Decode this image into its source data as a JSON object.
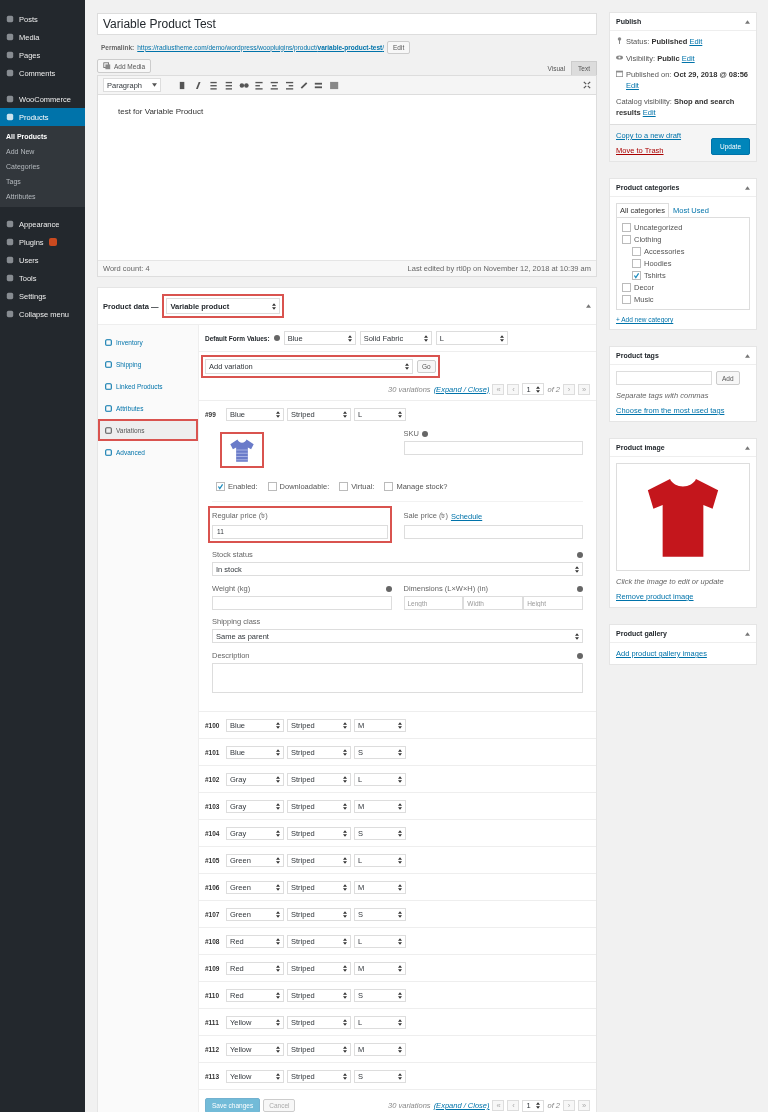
{
  "sidebar": {
    "groups": [
      [
        {
          "label": "Posts",
          "selected": false,
          "badge": false
        },
        {
          "label": "Media",
          "selected": false,
          "badge": false
        },
        {
          "label": "Pages",
          "selected": false,
          "badge": false
        },
        {
          "label": "Comments",
          "selected": false,
          "badge": false
        }
      ],
      [
        {
          "label": "WooCommerce",
          "selected": false,
          "badge": false
        },
        {
          "label": "Products",
          "selected": true,
          "badge": false,
          "children": [
            {
              "label": "All Products",
              "selected": true
            },
            {
              "label": "Add New",
              "selected": false
            },
            {
              "label": "Categories",
              "selected": false
            },
            {
              "label": "Tags",
              "selected": false
            },
            {
              "label": "Attributes",
              "selected": false
            }
          ]
        }
      ],
      [
        {
          "label": "Appearance",
          "selected": false,
          "badge": false
        },
        {
          "label": "Plugins",
          "selected": false,
          "badge": true
        },
        {
          "label": "Users",
          "selected": false,
          "badge": false
        },
        {
          "label": "Tools",
          "selected": false,
          "badge": false
        },
        {
          "label": "Settings",
          "selected": false,
          "badge": false
        },
        {
          "label": "Collapse menu",
          "selected": false,
          "badge": false
        }
      ]
    ]
  },
  "editor": {
    "title": "Variable Product Test",
    "permalink_label": "Permalink:",
    "permalink": "https://radiustheme.com/demo/wordpress/woopluigins/product/**variable-product-test**/",
    "edit_button": "Edit",
    "add_media": "Add Media",
    "tabs": [
      {
        "label": "Visual",
        "selected": false
      },
      {
        "label": "Text",
        "selected": true
      }
    ],
    "format": "Paragraph",
    "content": "test for Variable Product",
    "word_count": "Word count: 4",
    "last_edited": "Last edited by rtl0p on November 12, 2018 at 10:39 am"
  },
  "product_data": {
    "label": "Product data —",
    "type": {
      "value": "Variable product",
      "highlighted": true
    },
    "tabs": [
      {
        "label": "Inventory",
        "selected": false,
        "highlighted": false
      },
      {
        "label": "Shipping",
        "selected": false,
        "highlighted": false
      },
      {
        "label": "Linked Products",
        "selected": false,
        "highlighted": false
      },
      {
        "label": "Attributes",
        "selected": false,
        "highlighted": false
      },
      {
        "label": "Variations",
        "selected": true,
        "highlighted": true
      },
      {
        "label": "Advanced",
        "selected": false,
        "highlighted": false
      }
    ],
    "default_label": "Default Form Values:",
    "defaults": [
      "Blue",
      "Solid Fabric",
      "L"
    ],
    "bulk": {
      "value": "Add variation",
      "button": "Go",
      "highlighted": true
    },
    "pager": {
      "count": "30 variations",
      "toggle": "(Expand / Close)",
      "first": "«",
      "prev": "‹",
      "page": "1",
      "of": "of 2",
      "next": "›",
      "last": "»"
    },
    "variations": [
      {
        "id": "#99",
        "attributes": [
          "Blue",
          "Striped",
          "L"
        ],
        "details": {
          "image_highlighted": true,
          "sku_label": "SKU",
          "options": [
            {
              "label": "Enabled:",
              "checked": true
            },
            {
              "label": "Downloadable:",
              "checked": false
            },
            {
              "label": "Virtual:",
              "checked": false
            },
            {
              "label": "Manage stock?",
              "checked": false
            }
          ],
          "regular_price_label": "Regular price (৳)",
          "regular_price": "11",
          "price_highlighted": true,
          "sale_price_label": "Sale price (৳)",
          "schedule": "Schedule",
          "stock_label": "Stock status",
          "stock": "In stock",
          "weight_label": "Weight (kg)",
          "dimensions_label": "Dimensions (L×W×H) (in)",
          "dimension_placeholders": [
            "Length",
            "Width",
            "Height"
          ],
          "shipping_label": "Shipping class",
          "shipping": "Same as parent",
          "description_label": "Description"
        }
      },
      {
        "id": "#100",
        "attributes": [
          "Blue",
          "Striped",
          "M"
        ]
      },
      {
        "id": "#101",
        "attributes": [
          "Blue",
          "Striped",
          "S"
        ]
      },
      {
        "id": "#102",
        "attributes": [
          "Gray",
          "Striped",
          "L"
        ]
      },
      {
        "id": "#103",
        "attributes": [
          "Gray",
          "Striped",
          "M"
        ]
      },
      {
        "id": "#104",
        "attributes": [
          "Gray",
          "Striped",
          "S"
        ]
      },
      {
        "id": "#105",
        "attributes": [
          "Green",
          "Striped",
          "L"
        ]
      },
      {
        "id": "#106",
        "attributes": [
          "Green",
          "Striped",
          "M"
        ]
      },
      {
        "id": "#107",
        "attributes": [
          "Green",
          "Striped",
          "S"
        ]
      },
      {
        "id": "#108",
        "attributes": [
          "Red",
          "Striped",
          "L"
        ]
      },
      {
        "id": "#109",
        "attributes": [
          "Red",
          "Striped",
          "M"
        ]
      },
      {
        "id": "#110",
        "attributes": [
          "Red",
          "Striped",
          "S"
        ]
      },
      {
        "id": "#111",
        "attributes": [
          "Yellow",
          "Striped",
          "L"
        ]
      },
      {
        "id": "#112",
        "attributes": [
          "Yellow",
          "Striped",
          "M"
        ]
      },
      {
        "id": "#113",
        "attributes": [
          "Yellow",
          "Striped",
          "S"
        ]
      }
    ],
    "save_button": "Save changes",
    "save_disabled": true,
    "cancel_button": "Cancel",
    "footer_pager": {
      "count": "30 variations",
      "toggle": "(Expand / Close)",
      "first": "«",
      "prev": "‹",
      "page": "1",
      "of": "of 2",
      "next": "›",
      "last": "»"
    }
  },
  "publish": {
    "title": "Publish",
    "rows": [
      {
        "kind": "status",
        "label": "Status:",
        "value": "Published",
        "link": "Edit"
      },
      {
        "kind": "visibility",
        "label": "Visibility:",
        "value": "Public",
        "link": "Edit"
      },
      {
        "kind": "date",
        "label": "Published on:",
        "value": "Oct 29, 2018 @ 08:56",
        "link": "Edit"
      },
      {
        "kind": "catalog",
        "label": "Catalog visibility:",
        "value": "Shop and search results",
        "link": "Edit"
      }
    ],
    "copy": "Copy to a new draft",
    "trash": "Move to Trash",
    "update": "Update"
  },
  "categories": {
    "title": "Product categories",
    "tabs": [
      {
        "label": "All categories",
        "selected": true
      },
      {
        "label": "Most Used",
        "selected": false
      }
    ],
    "items": [
      {
        "label": "Uncategorized",
        "checked": false
      },
      {
        "label": "Clothing",
        "checked": false,
        "children": [
          {
            "label": "Accessories",
            "checked": false
          },
          {
            "label": "Hoodies",
            "checked": false
          },
          {
            "label": "Tshirts",
            "checked": true
          }
        ]
      },
      {
        "label": "Decor",
        "checked": false
      },
      {
        "label": "Music",
        "checked": false
      }
    ],
    "add_link": "+ Add new category"
  },
  "tags": {
    "title": "Product tags",
    "button": "Add",
    "hint": "Separate tags with commas",
    "link": "Choose from the most used tags"
  },
  "image": {
    "title": "Product image",
    "hint": "Click the image to edit or update",
    "link": "Remove product image"
  },
  "gallery": {
    "title": "Product gallery",
    "link": "Add product gallery images"
  }
}
